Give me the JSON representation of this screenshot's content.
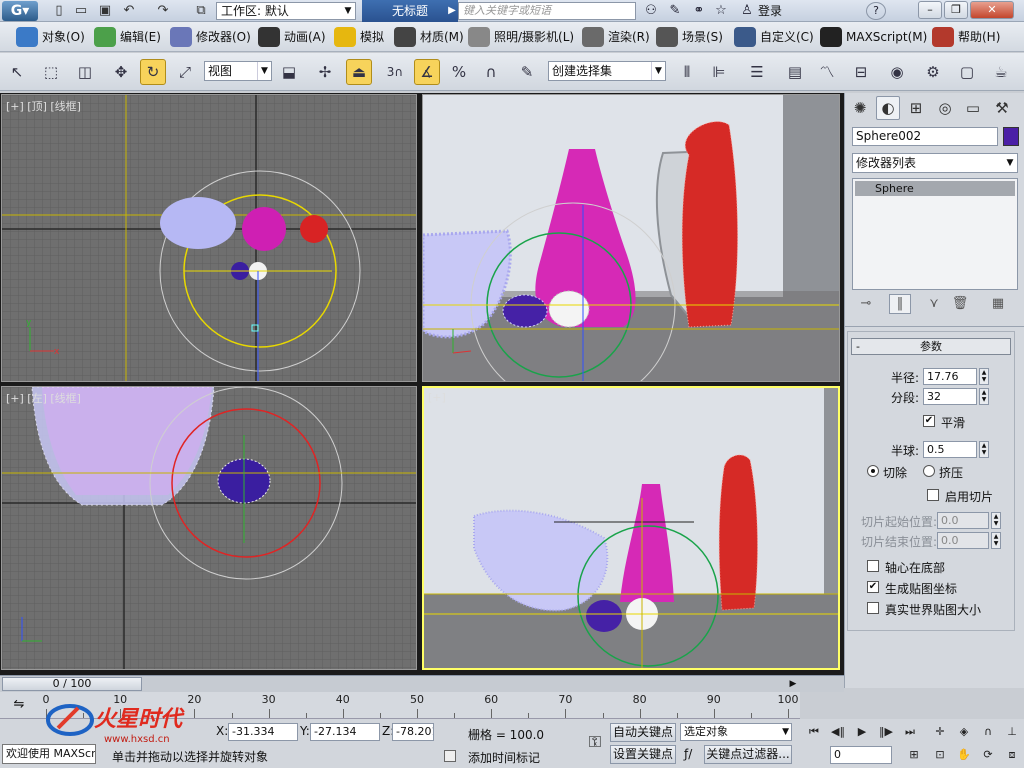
{
  "app": {
    "title": "无标题",
    "workspace_label": "工作区: 默认",
    "search_placeholder": "键入关键字或短语",
    "login_label": "登录",
    "help_icon": "?"
  },
  "menu": [
    {
      "label": "对象(O)",
      "icon": "objects-icon",
      "color": "#3b7ac7"
    },
    {
      "label": "编辑(E)",
      "icon": "edit-icon",
      "color": "#4ca04a"
    },
    {
      "label": "修改器(O)",
      "icon": "modifier-icon",
      "color": "#6a77b8"
    },
    {
      "label": "动画(A)",
      "icon": "animation-icon",
      "color": "#333333"
    },
    {
      "label": "模拟",
      "icon": "simulation-icon",
      "color": "#e6b70f"
    },
    {
      "label": "材质(M)",
      "icon": "material-icon",
      "color": "#444444"
    },
    {
      "label": "照明/摄影机(L)",
      "icon": "lighting-icon",
      "color": "#888888"
    },
    {
      "label": "渲染(R)",
      "icon": "render-icon",
      "color": "#6a6a6a"
    },
    {
      "label": "场景(S)",
      "icon": "scene-icon",
      "color": "#555555"
    },
    {
      "label": "自定义(C)",
      "icon": "customize-icon",
      "color": "#3b5a8a"
    },
    {
      "label": "MAXScript(M)",
      "icon": "maxscript-icon",
      "color": "#222222"
    },
    {
      "label": "帮助(H)",
      "icon": "help-icon",
      "color": "#b3392c"
    }
  ],
  "toolbar": {
    "view_select": "视图",
    "selection_set": "创建选择集",
    "snap_label": "3"
  },
  "viewports": {
    "top_label": "[+] [顶] [线框]",
    "perspective_label": "",
    "left_label": "[+] [左] [线框]",
    "camera_label": "[+]"
  },
  "command_panel": {
    "object_name": "Sphere002",
    "object_color": "#4b1fa6",
    "modifier_list": "修改器列表",
    "stack_item": "Sphere",
    "rollout_title": "参数",
    "rollout_toggle": "-",
    "radius_label": "半径:",
    "radius_value": "17.76",
    "segments_label": "分段:",
    "segments_value": "32",
    "smooth_label": "平滑",
    "hemisphere_label": "半球:",
    "hemisphere_value": "0.5",
    "chop_label": "切除",
    "squash_label": "挤压",
    "slice_on_label": "启用切片",
    "slice_from_label": "切片起始位置:",
    "slice_from_value": "0.0",
    "slice_to_label": "切片结束位置:",
    "slice_to_value": "0.0",
    "base_pivot_label": "轴心在底部",
    "gen_uv_label": "生成贴图坐标",
    "real_world_label": "真实世界贴图大小"
  },
  "timeline": {
    "frame_display": "0 / 100",
    "ticks": [
      "0",
      "10",
      "20",
      "30",
      "40",
      "50",
      "60",
      "70",
      "80",
      "90",
      "100"
    ]
  },
  "status": {
    "welcome": "欢迎使用 MAXScr",
    "prompt": "单击并拖动以选择并旋转对象",
    "x_label": "X:",
    "x_value": "-31.334",
    "y_label": "Y:",
    "y_value": "-27.134",
    "z_label": "Z:",
    "z_value": "-78.201",
    "grid_label": "栅格 = 100.0",
    "add_time_tag": "添加时间标记",
    "auto_key": "自动关键点",
    "set_key": "设置关键点",
    "selected_option": "选定对象",
    "key_filters": "关键点过滤器...",
    "frame_value": "0"
  },
  "watermark": {
    "logo_text": "火星时代",
    "url": "www.hxsd.cn"
  }
}
